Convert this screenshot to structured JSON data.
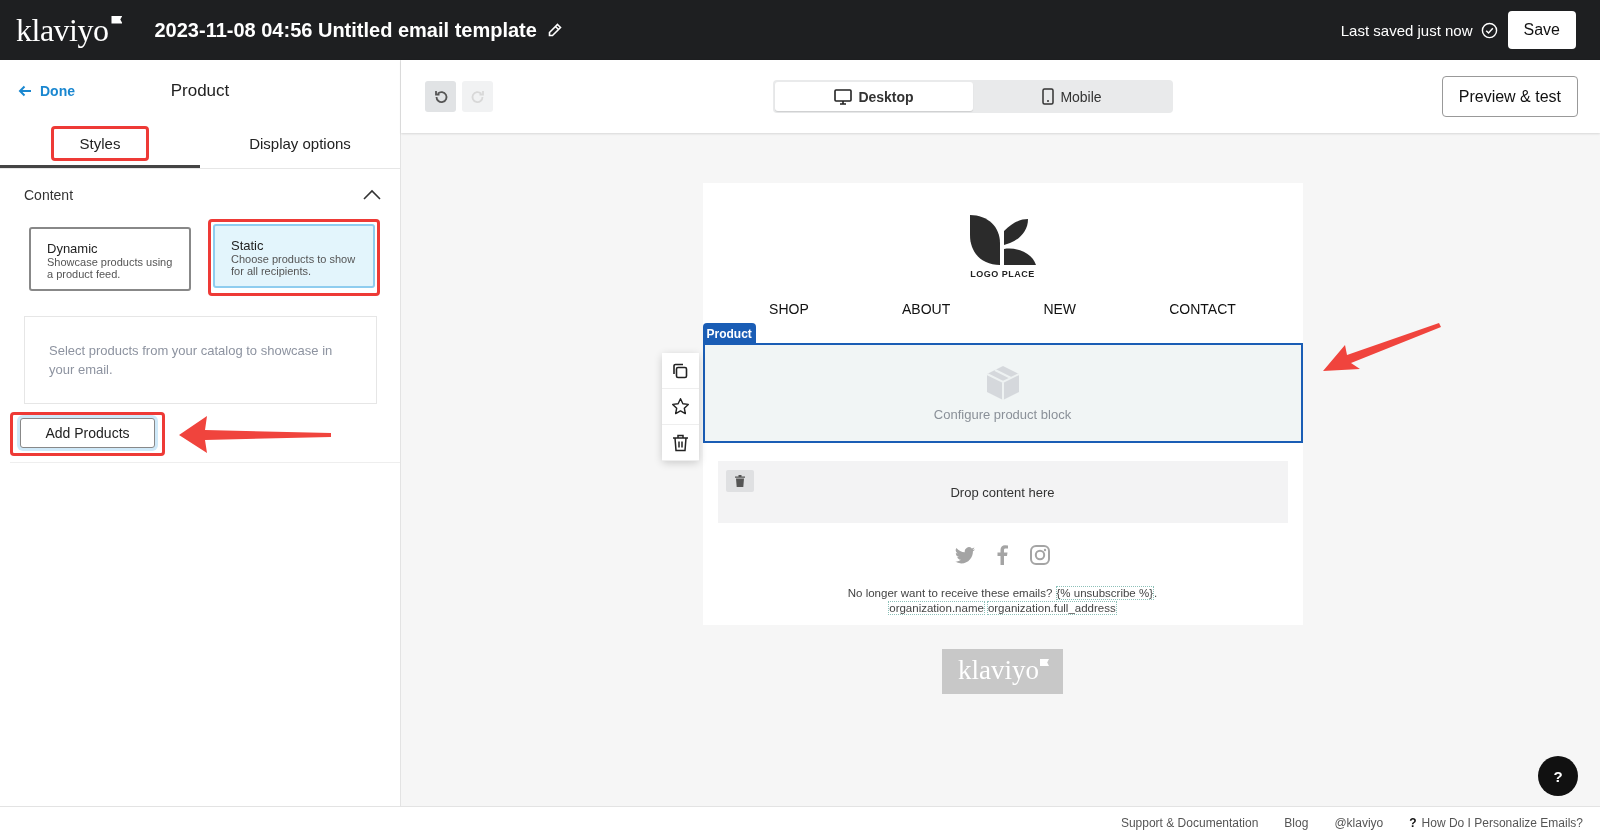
{
  "header": {
    "logo": "klaviyo",
    "title": "2023-11-08 04:56 Untitled email template",
    "save_status": "Last saved just now",
    "save_button": "Save"
  },
  "sidebar": {
    "back_link": "Done",
    "title": "Product",
    "tabs": [
      {
        "label": "Styles",
        "selected": true,
        "highlighted": true
      },
      {
        "label": "Display options",
        "selected": false,
        "highlighted": false
      }
    ],
    "section": {
      "title": "Content",
      "expanded": true
    },
    "content_types": [
      {
        "title": "Dynamic",
        "description": "Showcase products using a product feed.",
        "selected": false,
        "highlighted": false
      },
      {
        "title": "Static",
        "description": "Choose products to show for all recipients.",
        "selected": true,
        "highlighted": true
      }
    ],
    "info_text": "Select products from your catalog to showcase in your email.",
    "add_button": {
      "label": "Add Products",
      "highlighted": true,
      "arrow": true
    }
  },
  "toolbar": {
    "undo_disabled": false,
    "redo_disabled": true,
    "view_modes": [
      {
        "label": "Desktop",
        "kind": "desktop",
        "selected": true
      },
      {
        "label": "Mobile",
        "kind": "mobile",
        "selected": false
      }
    ],
    "preview_button": "Preview & test"
  },
  "email": {
    "logo_text": "LOGO PLACE",
    "nav": [
      "SHOP",
      "ABOUT",
      "NEW",
      "CONTACT"
    ],
    "product_block": {
      "tag": "Product",
      "text": "Configure product block",
      "selected": true,
      "arrow": true
    },
    "drop_zone": "Drop content here",
    "unsubscribe_text": "No longer want to receive these emails?",
    "unsubscribe_tag": "{% unsubscribe %}",
    "unsubscribe_end": ".",
    "address_tags": [
      "organization.name",
      "organization.full_address"
    ]
  },
  "brand_badge": "klaviyo",
  "help_button": "?",
  "footer_links": [
    {
      "label": "Support & Documentation"
    },
    {
      "label": "Blog"
    },
    {
      "label": "@klaviyo"
    },
    {
      "label": "How Do I Personalize Emails?",
      "icon": "?"
    }
  ]
}
